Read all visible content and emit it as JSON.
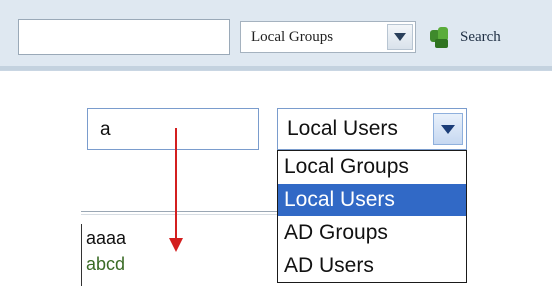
{
  "toolbar": {
    "search_value": "",
    "type_select": {
      "selected": "Local Groups"
    },
    "search_label": "Search"
  },
  "demo": {
    "input_value": "a",
    "select": {
      "selected": "Local Users",
      "options": [
        "Local Groups",
        "Local Users",
        "AD Groups",
        "AD Users"
      ],
      "highlighted_index": 1
    },
    "suggestions": [
      "aaaa",
      "abcd"
    ]
  },
  "colors": {
    "highlight": "#3169c6",
    "arrow": "#d31f1f",
    "suggestion_alt": "#3a6b25"
  }
}
